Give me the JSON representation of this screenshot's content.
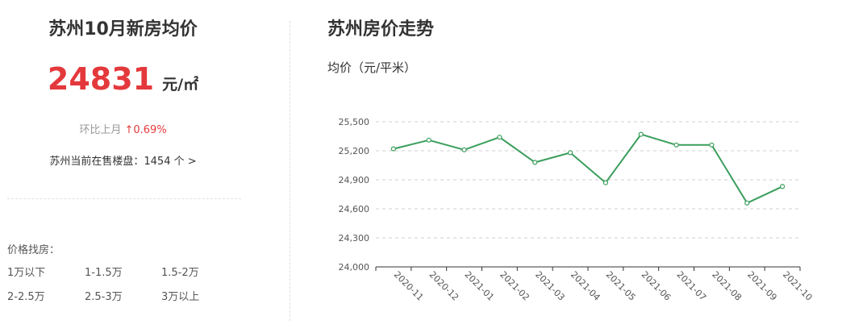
{
  "left": {
    "title": "苏州10月新房均价",
    "price_value": "24831",
    "price_unit": "元/㎡",
    "mom_label": "环比上月",
    "mom_arrow": "↑",
    "mom_value": "0.69%",
    "onsale_label": "苏州当前在售楼盘：",
    "onsale_count": "1454 个 >",
    "filter_label": "价格找房：",
    "filters": [
      "1万以下",
      "1-1.5万",
      "1.5-2万",
      "2-2.5万",
      "2.5-3万",
      "3万以上"
    ]
  },
  "colors": {
    "accent_red": "#e4393c",
    "line_green": "#3a9e5c"
  },
  "chart_data": {
    "type": "line",
    "title": "苏州房价走势",
    "ylabel": "均价（元/平米）",
    "xlabel": "",
    "categories": [
      "2020-11",
      "2020-12",
      "2021-01",
      "2021-02",
      "2021-03",
      "2021-04",
      "2021-05",
      "2021-06",
      "2021-07",
      "2021-08",
      "2021-09",
      "2021-10"
    ],
    "series": [
      {
        "values": [
          25220,
          25310,
          25210,
          25340,
          25080,
          25180,
          24870,
          25370,
          25260,
          25260,
          24660,
          24831
        ]
      }
    ],
    "ylim": [
      24000,
      25500
    ],
    "yticks": [
      24000,
      24300,
      24600,
      24900,
      25200,
      25500
    ],
    "ytick_labels": [
      "24,000",
      "24,300",
      "24,600",
      "24,900",
      "25,200",
      "25,500"
    ],
    "grid": true
  }
}
